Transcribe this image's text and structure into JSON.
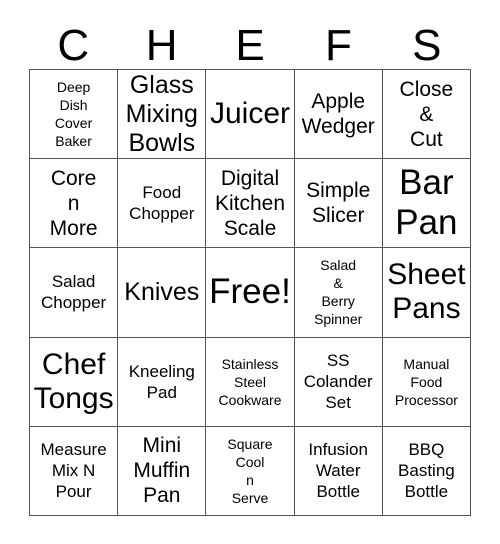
{
  "card": {
    "title_letters": [
      "C",
      "H",
      "E",
      "F",
      "S"
    ],
    "grid_size": 5,
    "free_space_label": "Free!",
    "colors": {
      "text": "#000000",
      "border": "#555555",
      "background": "#ffffff"
    },
    "rows": [
      [
        {
          "text": "Deep\nDish\nCover\nBaker",
          "size": "xs"
        },
        {
          "text": "Glass\nMixing\nBowls",
          "size": "lg"
        },
        {
          "text": "Juicer",
          "size": "xl"
        },
        {
          "text": "Apple\nWedger",
          "size": "md"
        },
        {
          "text": "Close\n&\nCut",
          "size": "md"
        }
      ],
      [
        {
          "text": "Core\nn\nMore",
          "size": "md"
        },
        {
          "text": "Food\nChopper",
          "size": "sm"
        },
        {
          "text": "Digital\nKitchen\nScale",
          "size": "md"
        },
        {
          "text": "Simple\nSlicer",
          "size": "md"
        },
        {
          "text": "Bar\nPan",
          "size": "xxl"
        }
      ],
      [
        {
          "text": "Salad\nChopper",
          "size": "sm"
        },
        {
          "text": "Knives",
          "size": "lg"
        },
        {
          "text": "Free!",
          "size": "xxl"
        },
        {
          "text": "Salad\n&\nBerry\nSpinner",
          "size": "xs"
        },
        {
          "text": "Sheet\nPans",
          "size": "xl"
        }
      ],
      [
        {
          "text": "Chef\nTongs",
          "size": "xl"
        },
        {
          "text": "Kneeling\nPad",
          "size": "sm"
        },
        {
          "text": "Stainless\nSteel\nCookware",
          "size": "xs"
        },
        {
          "text": "SS\nColander\nSet",
          "size": "sm"
        },
        {
          "text": "Manual\nFood\nProcessor",
          "size": "xs"
        }
      ],
      [
        {
          "text": "Measure\nMix N\nPour",
          "size": "sm"
        },
        {
          "text": "Mini\nMuffin\nPan",
          "size": "md"
        },
        {
          "text": "Square\nCool\nn\nServe",
          "size": "xs"
        },
        {
          "text": "Infusion\nWater\nBottle",
          "size": "sm"
        },
        {
          "text": "BBQ\nBasting\nBottle",
          "size": "sm"
        }
      ]
    ]
  }
}
